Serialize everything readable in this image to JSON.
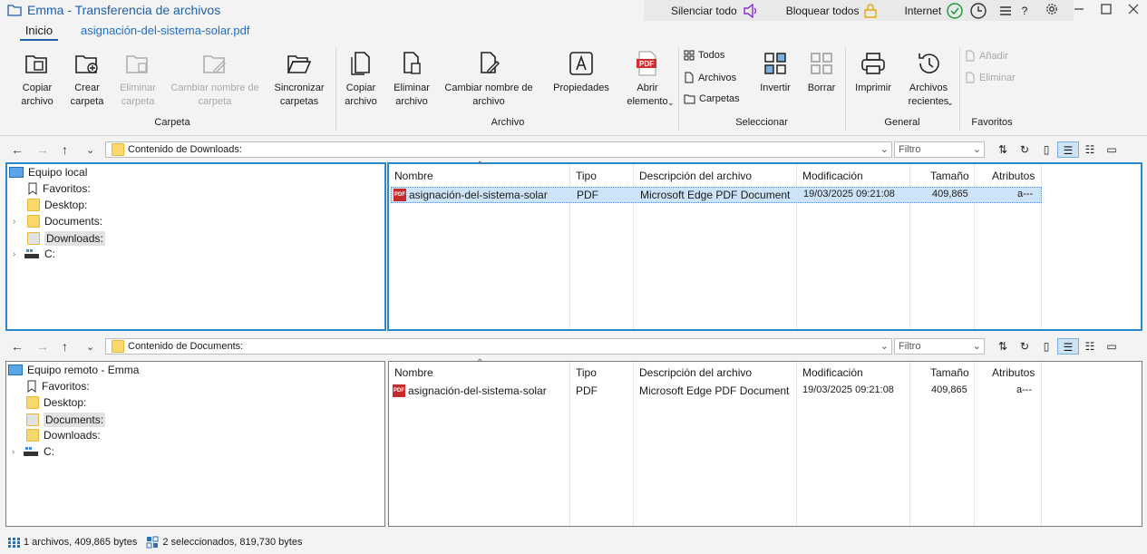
{
  "window": {
    "title": "Emma - Transferencia de archivos"
  },
  "quickbar": {
    "mute": "Silenciar todo",
    "lock": "Bloquear todos",
    "internet": "Internet"
  },
  "tabs": {
    "home": "Inicio",
    "file": "asignación-del-sistema-solar.pdf"
  },
  "ribbon": {
    "copy_file": "Copiar\narchivo",
    "create_folder": "Crear\ncarpeta",
    "delete_folder": "Eliminar\ncarpeta",
    "rename_folder": "Cambiar nombre de\ncarpeta",
    "sync_folders": "Sincronizar\ncarpetas",
    "copy_file2": "Copiar\narchivo",
    "delete_file": "Eliminar\narchivo",
    "rename_file": "Cambiar nombre de\narchivo",
    "properties": "Propiedades",
    "open_item": "Abrir\nelemento",
    "select_all": "Todos",
    "select_files": "Archivos",
    "select_folders": "Carpetas",
    "invert": "Invertir",
    "clear": "Borrar",
    "print": "Imprimir",
    "recent_files": "Archivos\nrecientes",
    "fav_add": "Añadir",
    "fav_remove": "Eliminar",
    "groups": {
      "folder": "Carpeta",
      "file": "Archivo",
      "select": "Seleccionar",
      "general": "General",
      "favorites": "Favoritos"
    }
  },
  "local": {
    "path": "Contenido de Downloads:",
    "filter_placeholder": "Filtro",
    "tree": {
      "root": "Equipo local",
      "items": [
        "Favoritos:",
        "Desktop:",
        "Documents:",
        "Downloads:",
        "C:"
      ]
    },
    "columns": [
      "Nombre",
      "Tipo",
      "Descripción del archivo",
      "Modificación",
      "Tamaño",
      "Atributos"
    ],
    "rows": [
      {
        "name": "asignación-del-sistema-solar",
        "type": "PDF",
        "desc": "Microsoft Edge PDF Document",
        "modified": "19/03/2025 09:21:08",
        "size": "409,865",
        "attr": "a---"
      }
    ]
  },
  "remote": {
    "path": "Contenido de Documents:",
    "filter_placeholder": "Filtro",
    "tree": {
      "root": "Equipo remoto - Emma",
      "items": [
        "Favoritos:",
        "Desktop:",
        "Documents:",
        "Downloads:",
        "C:"
      ]
    },
    "columns": [
      "Nombre",
      "Tipo",
      "Descripción del archivo",
      "Modificación",
      "Tamaño",
      "Atributos"
    ],
    "rows": [
      {
        "name": "asignación-del-sistema-solar",
        "type": "PDF",
        "desc": "Microsoft Edge PDF Document",
        "modified": "19/03/2025 09:21:08",
        "size": "409,865",
        "attr": "a---"
      }
    ]
  },
  "status": {
    "left": "1 archivos, 409,865 bytes",
    "right": "2 seleccionados, 819,730 bytes"
  },
  "colors": {
    "accent": "#1f5fa8",
    "active_border": "#2a89c8",
    "selection": "#cde4f8"
  }
}
